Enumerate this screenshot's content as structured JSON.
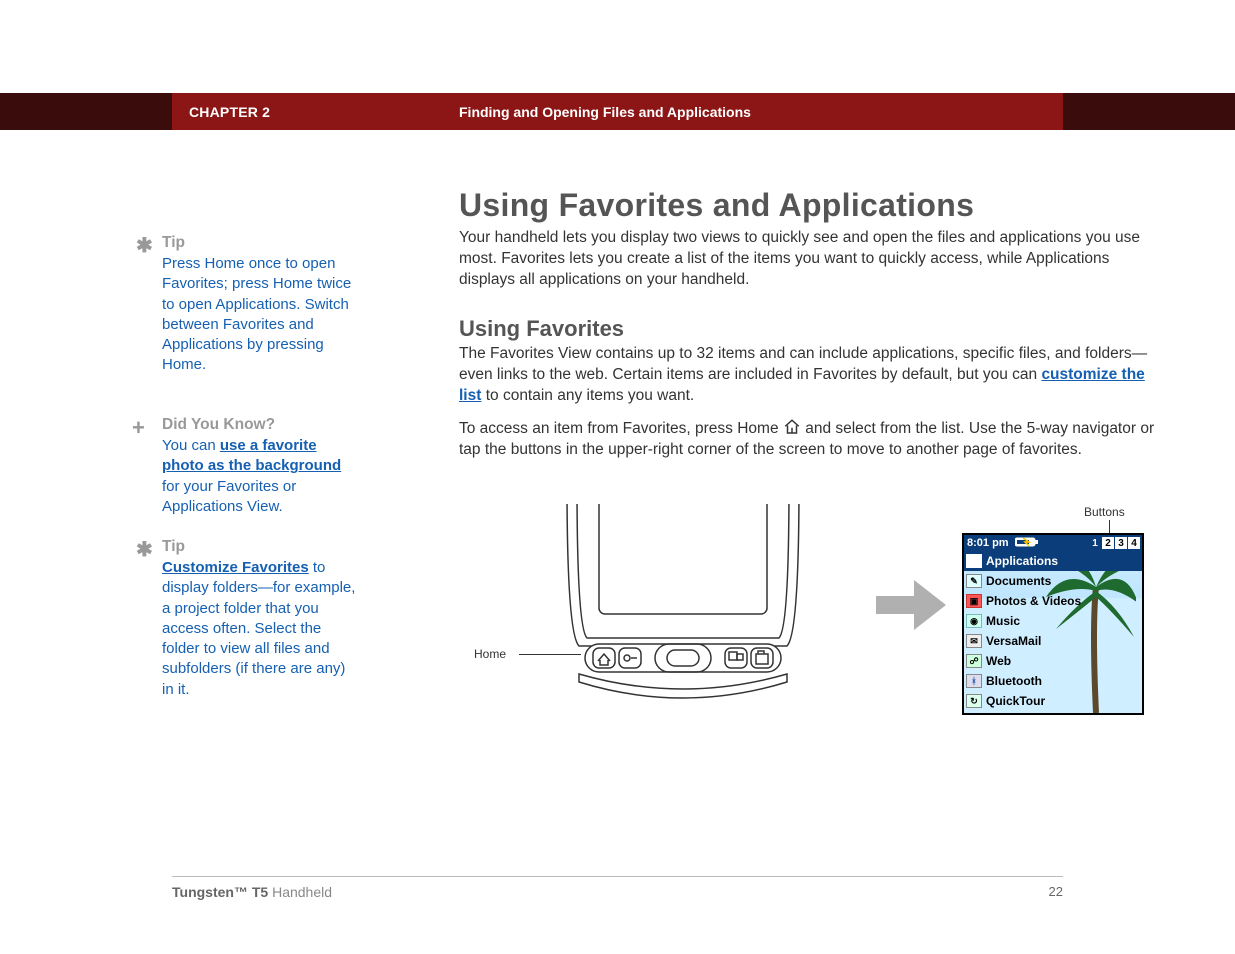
{
  "header": {
    "chapter_label": "CHAPTER 2",
    "chapter_title": "Finding and Opening Files and Applications"
  },
  "main": {
    "h1": "Using Favorites and Applications",
    "intro": "Your handheld lets you display two views to quickly see and open the files and applications you use most. Favorites lets you create a list of the items you want to quickly access, while Applications displays all applications on your handheld.",
    "h2": "Using Favorites",
    "p2a": "The Favorites View contains up to 32 items and can include applications, specific files, and folders—even links to the web. Certain items are included in Favorites by default, but you can ",
    "p2_link": "customize the list",
    "p2b": " to contain any items you want.",
    "p3a": "To access an item from Favorites, press Home ",
    "p3b": " and select from the list. Use the 5-way navigator or tap the buttons in the upper-right corner of the screen to move to another page of favorites."
  },
  "sidebar": {
    "tip1": {
      "head": "Tip",
      "body": "Press Home once to open Favorites; press Home twice to open Applications. Switch between Favorites and Applications by pressing Home."
    },
    "dyk": {
      "head": "Did You Know?",
      "pre": "You can ",
      "link": "use a favorite photo as the background",
      "post": " for your Favorites or Applications View."
    },
    "tip2": {
      "head": "Tip",
      "link": "Customize Favorites",
      "post": " to display folders—for example, a project folder that you access often. Select the folder to view all files and subfolders (if there are any) in it."
    }
  },
  "illus": {
    "home_label": "Home",
    "buttons_label": "Buttons",
    "status_time": "8:01 pm",
    "pages": [
      "1",
      "2",
      "3",
      "4"
    ],
    "active_page_index": 0,
    "rows": [
      {
        "label": "Applications",
        "selected": true
      },
      {
        "label": "Documents"
      },
      {
        "label": "Photos & Videos"
      },
      {
        "label": "Music"
      },
      {
        "label": "VersaMail"
      },
      {
        "label": "Web"
      },
      {
        "label": "Bluetooth"
      },
      {
        "label": "QuickTour"
      }
    ]
  },
  "footer": {
    "product_bold": "Tungsten™ T5",
    "product_rest": " Handheld",
    "page": "22"
  }
}
